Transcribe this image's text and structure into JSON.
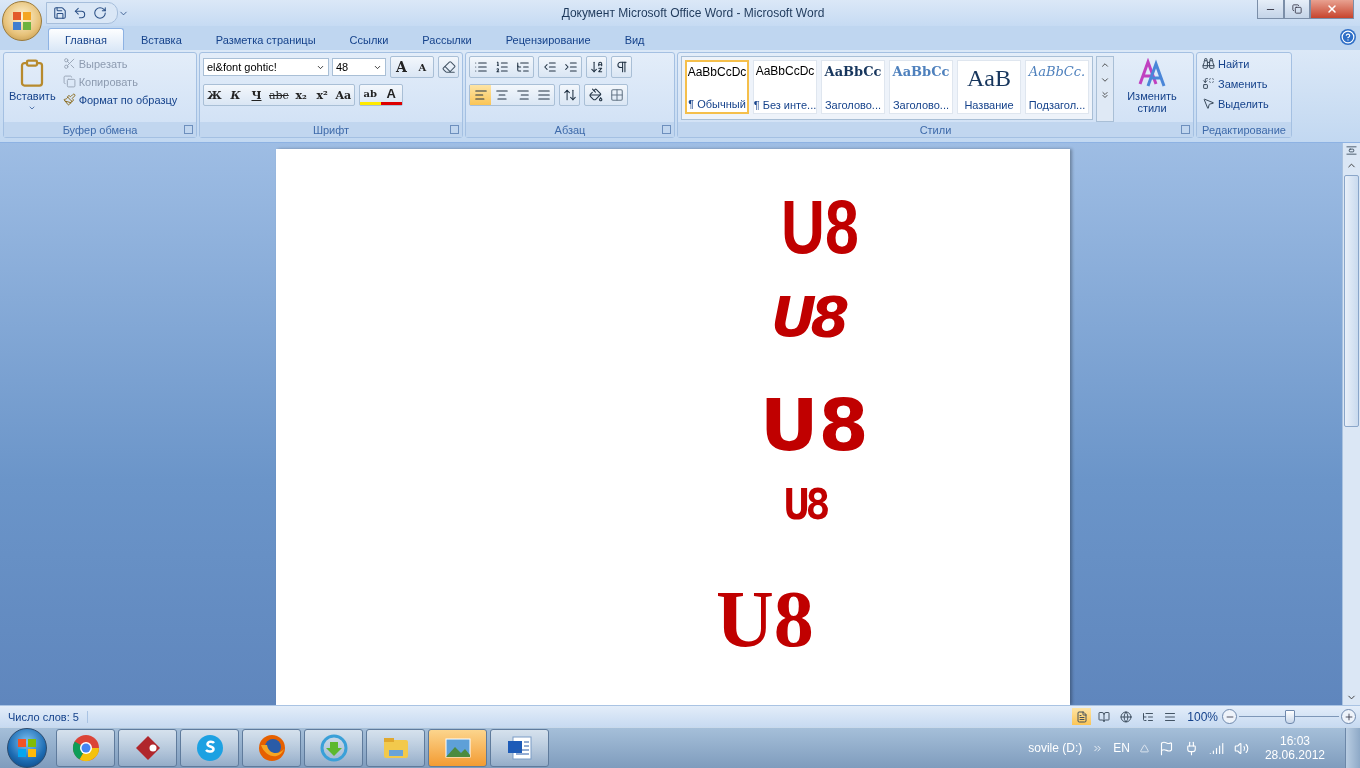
{
  "window": {
    "title": "Документ Microsoft Office Word - Microsoft Word"
  },
  "tabs": [
    {
      "label": "Главная",
      "selected": true
    },
    {
      "label": "Вставка",
      "selected": false
    },
    {
      "label": "Разметка страницы",
      "selected": false
    },
    {
      "label": "Ссылки",
      "selected": false
    },
    {
      "label": "Рассылки",
      "selected": false
    },
    {
      "label": "Рецензирование",
      "selected": false
    },
    {
      "label": "Вид",
      "selected": false
    }
  ],
  "clipboard": {
    "label": "Буфер обмена",
    "paste": "Вставить",
    "items": [
      {
        "kind": "cut",
        "label": "Вырезать",
        "disabled": true
      },
      {
        "kind": "copy",
        "label": "Копировать",
        "disabled": true
      },
      {
        "kind": "painter",
        "label": "Формат по образцу",
        "disabled": false
      }
    ]
  },
  "font": {
    "label": "Шрифт",
    "name": "el&font gohtic!",
    "size": "48",
    "grow": "A",
    "shrink": "A",
    "format_buttons": [
      {
        "kind": "bold",
        "text": "Ж"
      },
      {
        "kind": "italic",
        "text": "К"
      },
      {
        "kind": "underline",
        "text": "Ч"
      },
      {
        "kind": "strike",
        "text": "abc"
      },
      {
        "kind": "sub",
        "text": "x₂"
      },
      {
        "kind": "sup",
        "text": "x²"
      },
      {
        "kind": "case",
        "text": "Aa"
      }
    ],
    "highlight": "ab",
    "text_color_letter": "A"
  },
  "paragraph": {
    "label": "Абзац",
    "alignments": [
      {
        "kind": "left",
        "selected": true
      },
      {
        "kind": "center",
        "selected": false
      },
      {
        "kind": "right",
        "selected": false
      },
      {
        "kind": "justify",
        "selected": false
      }
    ]
  },
  "styles": {
    "label": "Стили",
    "change": "Изменить стили",
    "items": [
      {
        "kind": "normal",
        "preview": "AaBbCcDc",
        "name": "¶ Обычный",
        "selected": true
      },
      {
        "kind": "normal",
        "preview": "AaBbCcDc",
        "name": "¶ Без инте...",
        "selected": false
      },
      {
        "kind": "heading1",
        "preview": "AaBbCc",
        "name": "Заголово...",
        "selected": false
      },
      {
        "kind": "heading2",
        "preview": "AaBbCc",
        "name": "Заголово...",
        "selected": false
      },
      {
        "kind": "title",
        "preview": "AaB",
        "name": "Название",
        "selected": false
      },
      {
        "kind": "subtitle",
        "preview": "AaBbCc.",
        "name": "Подзагол...",
        "selected": false
      }
    ]
  },
  "editing": {
    "label": "Редактирование",
    "items": [
      {
        "kind": "find",
        "label": "Найти"
      },
      {
        "kind": "replace",
        "label": "Заменить"
      },
      {
        "kind": "select",
        "label": "Выделить"
      }
    ]
  },
  "document": {
    "lines": [
      {
        "kind": "rough",
        "text": "U8"
      },
      {
        "kind": "scratched",
        "text": "U8"
      },
      {
        "kind": "splatter",
        "text": "U8"
      },
      {
        "kind": "stencil",
        "text": "U8"
      },
      {
        "kind": "serif",
        "text": "U8"
      }
    ]
  },
  "status_bar": {
    "word_count": "Число слов: 5",
    "views": [
      {
        "kind": "print",
        "selected": true
      },
      {
        "kind": "reading",
        "selected": false
      },
      {
        "kind": "web",
        "selected": false
      },
      {
        "kind": "outline",
        "selected": false
      },
      {
        "kind": "draft",
        "selected": false
      }
    ],
    "zoom": "100%",
    "zoom_slider": {
      "level": 0.5
    }
  },
  "taskbar": {
    "apps": [
      {
        "kind": "chrome",
        "selected": false
      },
      {
        "kind": "cubase",
        "selected": false
      },
      {
        "kind": "skype",
        "selected": false
      },
      {
        "kind": "firefox",
        "selected": false
      },
      {
        "kind": "download",
        "selected": false
      },
      {
        "kind": "explorer",
        "selected": false
      },
      {
        "kind": "photos",
        "selected": true
      },
      {
        "kind": "word",
        "selected": false
      }
    ],
    "drive": "sovile (D:)",
    "language": "EN",
    "time": "16:03",
    "date": "28.06.2012"
  }
}
